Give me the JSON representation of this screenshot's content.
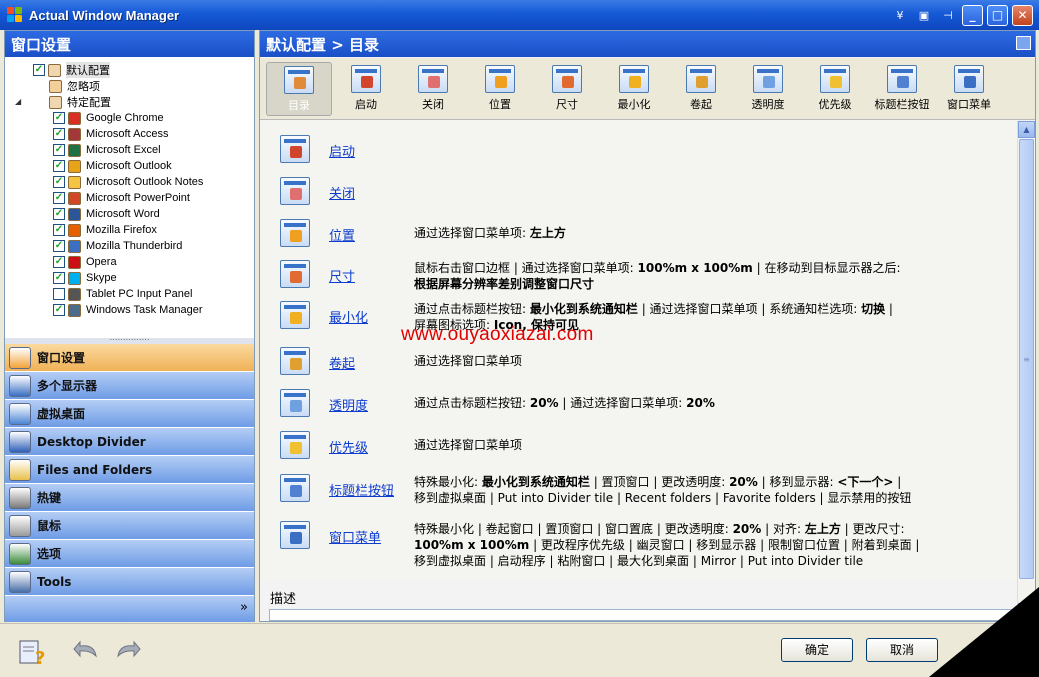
{
  "window": {
    "title": "Actual Window Manager",
    "controls": [
      "minimize",
      "maximize",
      "close"
    ]
  },
  "left_pane": {
    "header": "窗口设置",
    "tree": [
      {
        "label": "默认配置",
        "checked": true,
        "selected": true
      },
      {
        "label": "忽略项",
        "checked": null
      },
      {
        "label": "特定配置",
        "checked": null
      },
      {
        "label": "Google Chrome",
        "checked": true,
        "icon": "chrome-icon",
        "color": "#d93025"
      },
      {
        "label": "Microsoft Access",
        "checked": true,
        "icon": "access-icon",
        "color": "#a4373a"
      },
      {
        "label": "Microsoft Excel",
        "checked": true,
        "icon": "excel-icon",
        "color": "#1e7145"
      },
      {
        "label": "Microsoft Outlook",
        "checked": true,
        "icon": "outlook-icon",
        "color": "#e8a317"
      },
      {
        "label": "Microsoft Outlook Notes",
        "checked": true,
        "icon": "notes-icon",
        "color": "#f4c542"
      },
      {
        "label": "Microsoft PowerPoint",
        "checked": true,
        "icon": "powerpoint-icon",
        "color": "#d24726"
      },
      {
        "label": "Microsoft Word",
        "checked": true,
        "icon": "word-icon",
        "color": "#2b579a"
      },
      {
        "label": "Mozilla Firefox",
        "checked": true,
        "icon": "firefox-icon",
        "color": "#e66000"
      },
      {
        "label": "Mozilla Thunderbird",
        "checked": true,
        "icon": "thunderbird-icon",
        "color": "#3a6fc4"
      },
      {
        "label": "Opera",
        "checked": true,
        "icon": "opera-icon",
        "color": "#cc0f16"
      },
      {
        "label": "Skype",
        "checked": true,
        "icon": "skype-icon",
        "color": "#00aff0"
      },
      {
        "label": "Tablet PC Input Panel",
        "checked": false,
        "icon": "tablet-icon",
        "color": "#555555"
      },
      {
        "label": "Windows Task Manager",
        "checked": true,
        "icon": "taskmgr-icon",
        "color": "#4a6b8a"
      }
    ],
    "nav": [
      {
        "label": "窗口设置",
        "active": true
      },
      {
        "label": "多个显示器"
      },
      {
        "label": "虚拟桌面"
      },
      {
        "label": "Desktop Divider"
      },
      {
        "label": "Files and Folders"
      },
      {
        "label": "热键"
      },
      {
        "label": "鼠标"
      },
      {
        "label": "选项"
      },
      {
        "label": "Tools"
      }
    ],
    "nav_more": "»"
  },
  "right_pane": {
    "header": "默认配置 > 目录",
    "toolbar": [
      {
        "label": "目录",
        "active": true
      },
      {
        "label": "启动"
      },
      {
        "label": "关闭"
      },
      {
        "label": "位置"
      },
      {
        "label": "尺寸"
      },
      {
        "label": "最小化"
      },
      {
        "label": "卷起"
      },
      {
        "label": "透明度"
      },
      {
        "label": "优先级"
      },
      {
        "label": "标题栏按钮"
      },
      {
        "label": "窗口菜单"
      }
    ],
    "rows": [
      {
        "link": "启动",
        "desc": ""
      },
      {
        "link": "关闭",
        "desc": ""
      },
      {
        "link": "位置",
        "desc": "通过选择窗口菜单项: <b>左上方</b>"
      },
      {
        "link": "尺寸",
        "desc": "鼠标右击窗口边框 | 通过选择窗口菜单项: <b>100%m x 100%m</b> | 在移动到目标显示器之后:<br><b>根据屏幕分辨率差别调整窗口尺寸</b>"
      },
      {
        "link": "最小化",
        "desc": "通过点击标题栏按钮: <b>最小化到系统通知栏</b> | 通过选择窗口菜单项 | 系统通知栏选项: <b>切换</b> |<br>屏幕图标选项: <b>Icon, 保持可见</b>"
      },
      {
        "link": "卷起",
        "desc": "通过选择窗口菜单项"
      },
      {
        "link": "透明度",
        "desc": "通过点击标题栏按钮: <b>20%</b> | 通过选择窗口菜单项: <b>20%</b>"
      },
      {
        "link": "优先级",
        "desc": "通过选择窗口菜单项"
      },
      {
        "link": "标题栏按钮",
        "desc": "特殊最小化: <b>最小化到系统通知栏</b> | 置顶窗口 | 更改透明度: <b>20%</b> | 移到显示器: <b>&lt;下一个&gt;</b> |<br>移到虚拟桌面 | Put into Divider tile | Recent folders | Favorite folders | 显示禁用的按钮"
      },
      {
        "link": "窗口菜单",
        "desc": "特殊最小化 | 卷起窗口 | 置顶窗口 | 窗口置底 | 更改透明度: <b>20%</b> | 对齐: <b>左上方</b> | 更改尺寸:<br><b>100%m x 100%m</b> | 更改程序优先级 | 幽灵窗口 | 移到显示器 | 限制窗口位置 | 附着到桌面 |<br>移到虚拟桌面 | 启动程序 | 粘附窗口 | 最大化到桌面 | Mirror | Put into Divider tile"
      }
    ],
    "description_label": "描述",
    "watermark": "www.ouyaoxiazai.com"
  },
  "footer": {
    "ok_label": "确定",
    "cancel_label": "取消"
  },
  "colors": {
    "titlebar": "#1559d6",
    "link": "#0d3ccf",
    "nav_active": "#f0b257"
  }
}
